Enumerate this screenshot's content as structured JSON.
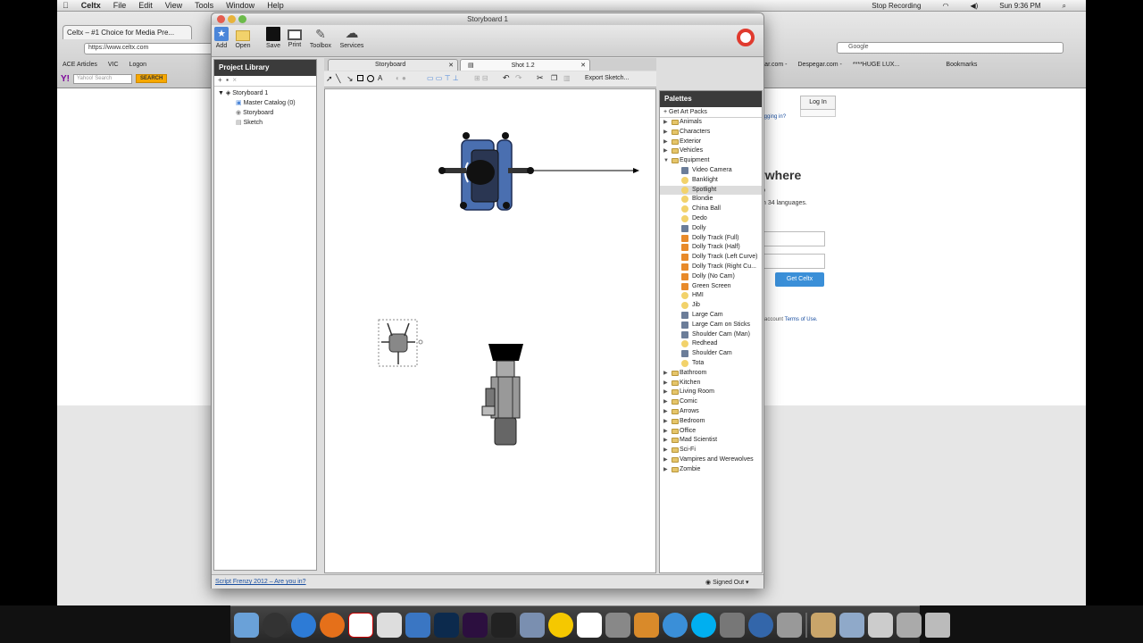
{
  "menubar": {
    "apple": "",
    "app": "Celtx",
    "items": [
      "File",
      "Edit",
      "View",
      "Tools",
      "Window",
      "Help"
    ],
    "recording": "Stop Recording",
    "clock": "Sun 9:36 PM"
  },
  "browser": {
    "tab_title": "Celtx – #1 Choice for Media Pre...",
    "url": "https://www.celtx.com",
    "search_placeholder": "Google",
    "bookmarks": [
      "ACE Articles",
      "VIC",
      "Logon",
      "Despegar.com -",
      "Despegar.com -",
      "****HUGE LUX...",
      "Bookmarks"
    ],
    "yahoo_logo": "Y!",
    "yahoo_placeholder": "Yahoo! Search",
    "yahoo_search": "SEARCH",
    "page": {
      "login": "Log In",
      "logged": "logging in?",
      "heading": "ywhere",
      "sub1": "p",
      "sub2": "n 34 languages.",
      "get_celtx": "Get Celtx",
      "terms_prefix": "account",
      "terms_link": "Terms of Use."
    }
  },
  "celtx": {
    "title": "Storyboard 1",
    "toolbar": [
      "Add",
      "Open",
      "Save",
      "Print",
      "Toolbox",
      "Services"
    ],
    "library": {
      "title": "Project Library",
      "root": "Storyboard 1",
      "children": [
        "Master Catalog (0)",
        "Storyboard",
        "Sketch"
      ]
    },
    "tabs": [
      "Storyboard",
      "Shot 1.2"
    ],
    "export": "Export Sketch...",
    "palettes": {
      "title": "Palettes",
      "get_art": "+ Get Art Packs",
      "folders_top": [
        "Animals",
        "Characters",
        "Exterior",
        "Vehicles",
        "Equipment"
      ],
      "equipment": [
        "Video Camera",
        "Banklight",
        "Spotlight",
        "Blondie",
        "China Ball",
        "Dedo",
        "Dolly",
        "Dolly Track (Full)",
        "Dolly Track (Half)",
        "Dolly Track (Left Curve)",
        "Dolly Track (Right Cu...",
        "Dolly (No Cam)",
        "Green Screen",
        "HMI",
        "Jib",
        "Large Cam",
        "Large Cam on Sticks",
        "Shoulder Cam (Man)",
        "Redhead",
        "Shoulder Cam",
        "Tota"
      ],
      "folders_bottom": [
        "Bathroom",
        "Kitchen",
        "Living Room",
        "Comic",
        "Arrows",
        "Bedroom",
        "Office",
        "Mad Scientist",
        "Sci-Fi",
        "Vampires and Werewolves",
        "Zombie"
      ],
      "selected": "Spotlight"
    },
    "status_link": "Script Frenzy 2012 – Are you in?",
    "signed_out": "Signed Out"
  },
  "colors": {
    "accent": "#3b3b3b",
    "link": "#1a4fa0",
    "blue_button": "#3a8fd8"
  }
}
